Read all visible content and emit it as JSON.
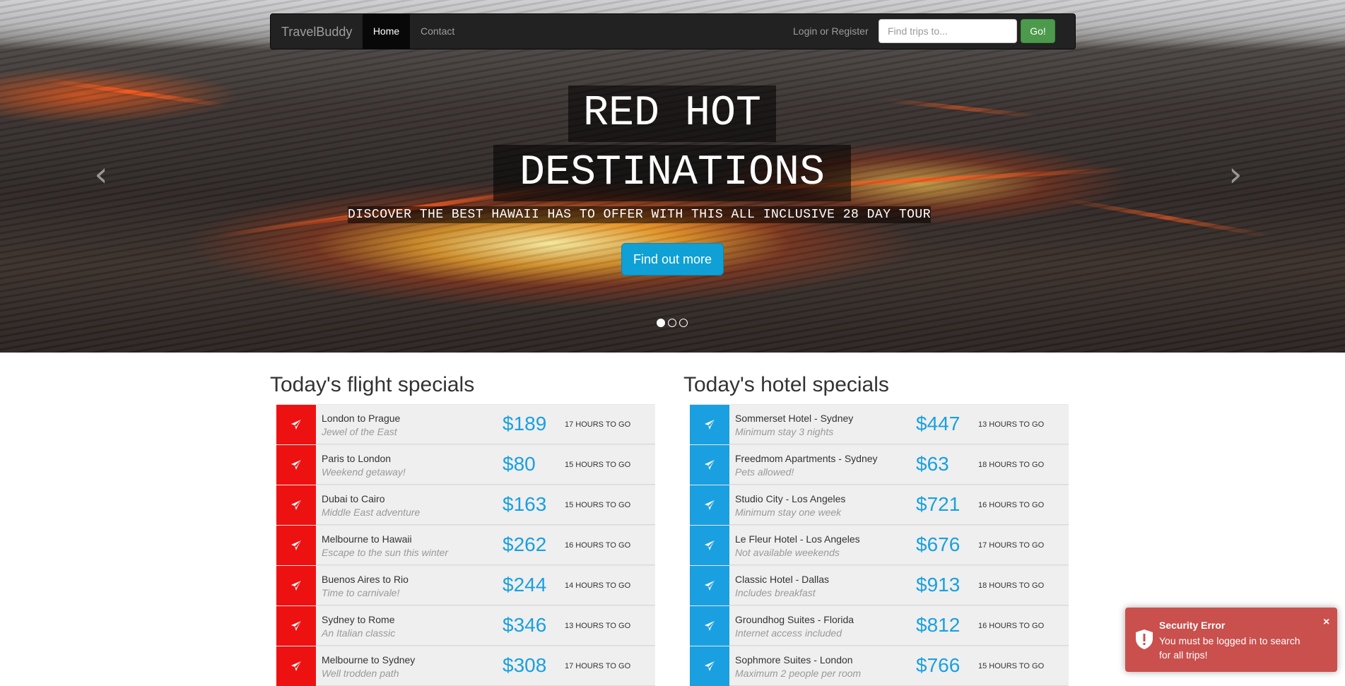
{
  "navbar": {
    "brand": "TravelBuddy",
    "home_label": "Home",
    "contact_label": "Contact",
    "login_label": "Login or Register",
    "search_placeholder": "Find trips to...",
    "go_label": "Go!"
  },
  "hero": {
    "title_line1": "RED HOT",
    "title_line2": "DESTINATIONS",
    "subtitle": "DISCOVER THE BEST HAWAII HAS TO OFFER WITH THIS ALL INCLUSIVE 28 DAY TOUR",
    "button_label": "Find out more",
    "prev_arrow": "‹",
    "next_arrow": "›",
    "slide_count": 3,
    "active_slide": 1
  },
  "flights": {
    "title": "Today's flight specials",
    "icon": "plane-icon",
    "items": [
      {
        "name": "London to Prague",
        "sub": "Jewel of the East",
        "price": "$189",
        "hours": "17 HOURS TO GO"
      },
      {
        "name": "Paris to London",
        "sub": "Weekend getaway!",
        "price": "$80",
        "hours": "15 HOURS TO GO"
      },
      {
        "name": "Dubai to Cairo",
        "sub": "Middle East adventure",
        "price": "$163",
        "hours": "15 HOURS TO GO"
      },
      {
        "name": "Melbourne to Hawaii",
        "sub": "Escape to the sun this winter",
        "price": "$262",
        "hours": "16 HOURS TO GO"
      },
      {
        "name": "Buenos Aires to Rio",
        "sub": "Time to carnivale!",
        "price": "$244",
        "hours": "14 HOURS TO GO"
      },
      {
        "name": "Sydney to Rome",
        "sub": "An Italian classic",
        "price": "$346",
        "hours": "13 HOURS TO GO"
      },
      {
        "name": "Melbourne to Sydney",
        "sub": "Well trodden path",
        "price": "$308",
        "hours": "17 HOURS TO GO"
      }
    ]
  },
  "hotels": {
    "title": "Today's hotel specials",
    "icon": "plane-icon",
    "items": [
      {
        "name": "Sommerset Hotel - Sydney",
        "sub": "Minimum stay 3 nights",
        "price": "$447",
        "hours": "13 HOURS TO GO"
      },
      {
        "name": "Freedmom Apartments - Sydney",
        "sub": "Pets allowed!",
        "price": "$63",
        "hours": "18 HOURS TO GO"
      },
      {
        "name": "Studio City - Los Angeles",
        "sub": "Minimum stay one week",
        "price": "$721",
        "hours": "16 HOURS TO GO"
      },
      {
        "name": "Le Fleur Hotel - Los Angeles",
        "sub": "Not available weekends",
        "price": "$676",
        "hours": "17 HOURS TO GO"
      },
      {
        "name": "Classic Hotel - Dallas",
        "sub": "Includes breakfast",
        "price": "$913",
        "hours": "18 HOURS TO GO"
      },
      {
        "name": "Groundhog Suites - Florida",
        "sub": "Internet access included",
        "price": "$812",
        "hours": "16 HOURS TO GO"
      },
      {
        "name": "Sophmore Suites - London",
        "sub": "Maximum 2 people per room",
        "price": "$766",
        "hours": "15 HOURS TO GO"
      }
    ]
  },
  "toast": {
    "title": "Security Error",
    "message": "You must be logged in to search for all trips!",
    "close": "×",
    "icon": "shield-alert-icon"
  },
  "colors": {
    "flight_tile": "#ee1111",
    "hotel_tile": "#1aa0e0",
    "price": "#1aa0e0",
    "go_button": "#4d9a4d",
    "hero_button": "#0fa0d6",
    "toast_bg": "#c9504d"
  }
}
